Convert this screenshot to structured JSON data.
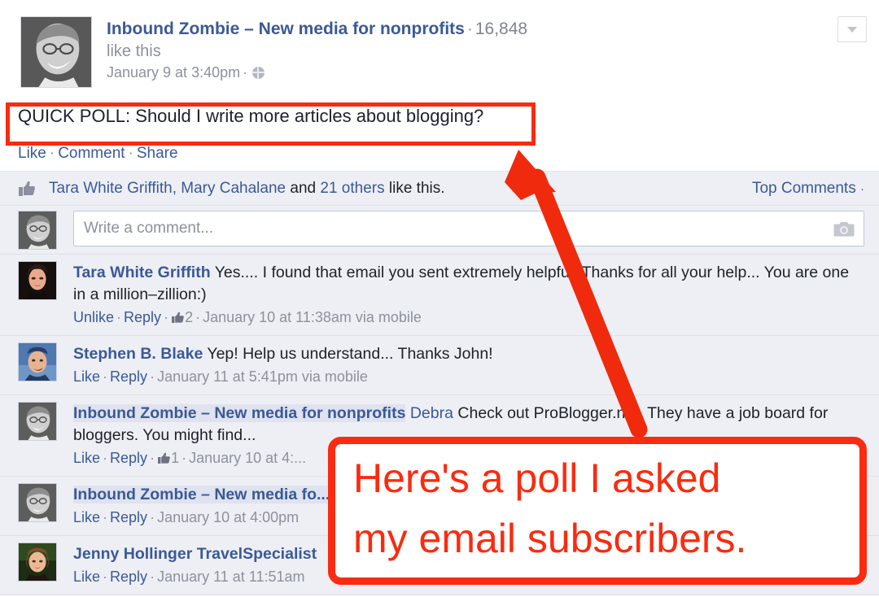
{
  "post": {
    "page_name": "Inbound Zombie – New media for nonprofits",
    "separator": "·",
    "like_count": "16,848",
    "like_this_label": "like this",
    "timestamp": "January 9 at 3:40pm",
    "timestamp_separator": "·",
    "privacy_icon": "globe-icon",
    "dropdown_icon": "chevron-down-icon",
    "message": "QUICK POLL: Should I write more articles about blogging?"
  },
  "actions": {
    "like": "Like",
    "comment": "Comment",
    "share": "Share",
    "dot": "·"
  },
  "likes_bar": {
    "thumb_icon": "thumbs-up-icon",
    "names": "Tara White Griffith, Mary Cahalane",
    "and": " and ",
    "others": "21 others",
    "suffix": " like this.",
    "sort_label": "Top Comments",
    "sort_caret": "·"
  },
  "composer": {
    "placeholder": "Write a comment...",
    "camera_icon": "camera-icon"
  },
  "comments": [
    {
      "author": "Tara White Griffith",
      "author_highlight": false,
      "tag": "",
      "body": " Yes.... I found that email you sent extremely helpful! Thanks for all your help... You are one in a million–zillion:)",
      "like_action": "Unlike",
      "reply_action": "Reply",
      "like_count": "2",
      "has_like_count": true,
      "meta_time": "January 10 at 11:38am via mobile",
      "avatar": "avatar-tara"
    },
    {
      "author": "Stephen B. Blake",
      "author_highlight": false,
      "tag": "",
      "body": " Yep! Help us understand... Thanks John!",
      "like_action": "Like",
      "reply_action": "Reply",
      "like_count": "",
      "has_like_count": false,
      "meta_time": "January 11 at 5:41pm via mobile",
      "avatar": "avatar-stephen"
    },
    {
      "author": "Inbound Zombie – New media for nonprofits",
      "author_highlight": true,
      "tag": "Debra",
      "body": " Check out ProBlogger.net. They have a job board for bloggers. You might find...",
      "like_action": "Like",
      "reply_action": "Reply",
      "like_count": "1",
      "has_like_count": true,
      "meta_time": "January 10 at 4:...",
      "avatar": "avatar-inbound"
    },
    {
      "author": "Inbound Zombie – New media fo...",
      "author_highlight": true,
      "tag": "",
      "body": "",
      "like_action": "Like",
      "reply_action": "Reply",
      "like_count": "",
      "has_like_count": false,
      "meta_time": "January 10 at 4:00pm",
      "avatar": "avatar-inbound"
    },
    {
      "author": "Jenny Hollinger TravelSpecialist",
      "author_highlight": false,
      "tag": "",
      "body": "",
      "like_action": "Like",
      "reply_action": "Reply",
      "like_count": "",
      "has_like_count": false,
      "meta_time": "January 11 at 11:51am",
      "avatar": "avatar-jenny"
    }
  ],
  "annotation": {
    "highlight_box": "red-rectangle-around-post-text",
    "arrow": "red-arrow-pointing-up",
    "callout_line1": "Here's a poll I asked",
    "callout_line2": "my email subscribers.",
    "color": "#fa2b10"
  },
  "colors": {
    "link_blue": "#3b5998",
    "body_bg": "#edeff4",
    "text": "#1d2129",
    "muted": "#8d919c",
    "annotation_red": "#fa2b10"
  }
}
